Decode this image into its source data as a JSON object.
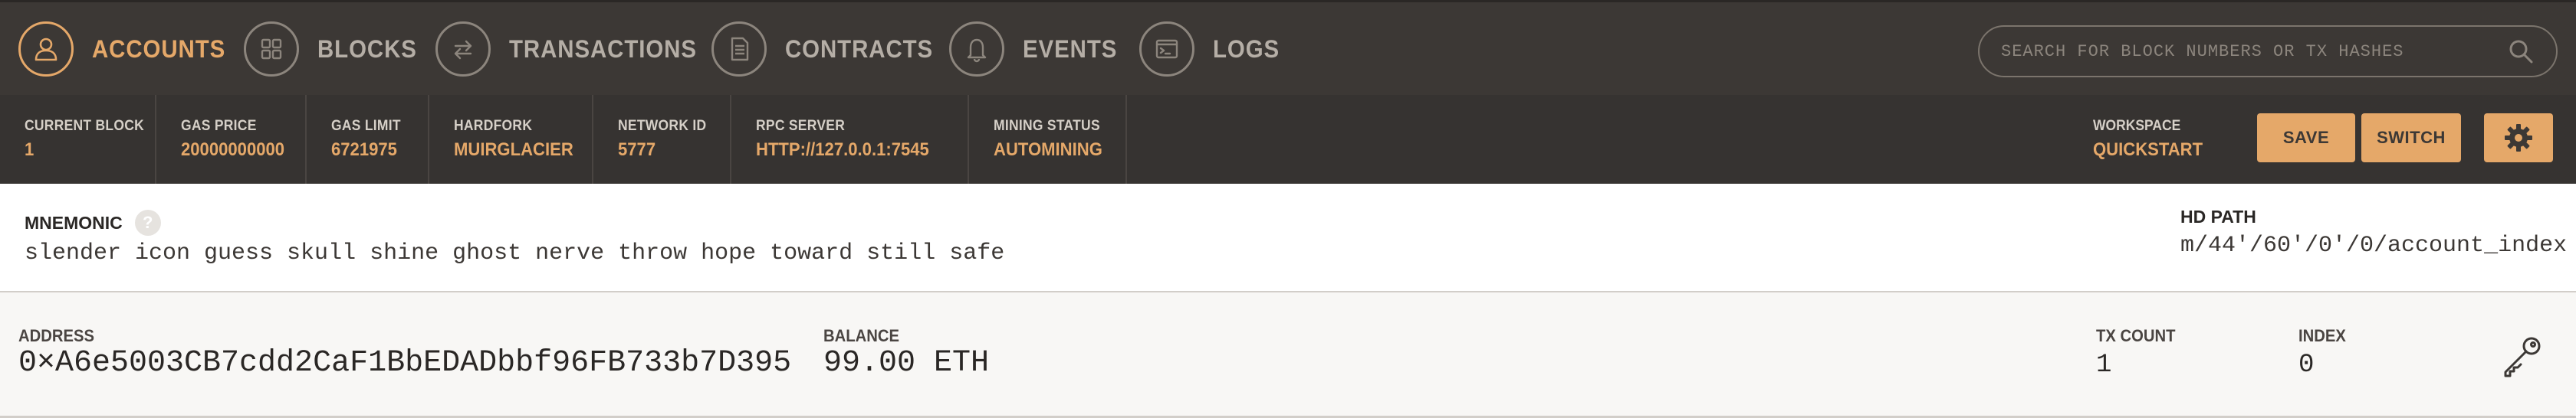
{
  "nav": {
    "items": [
      {
        "label": "ACCOUNTS",
        "icon": "user-icon",
        "active": true
      },
      {
        "label": "BLOCKS",
        "icon": "grid-icon",
        "active": false
      },
      {
        "label": "TRANSACTIONS",
        "icon": "swap-arrows-icon",
        "active": false
      },
      {
        "label": "CONTRACTS",
        "icon": "document-icon",
        "active": false
      },
      {
        "label": "EVENTS",
        "icon": "bell-icon",
        "active": false
      },
      {
        "label": "LOGS",
        "icon": "terminal-icon",
        "active": false
      }
    ],
    "search_placeholder": "SEARCH FOR BLOCK NUMBERS OR TX HASHES"
  },
  "status": {
    "current_block": {
      "label": "CURRENT BLOCK",
      "value": "1"
    },
    "gas_price": {
      "label": "GAS PRICE",
      "value": "20000000000"
    },
    "gas_limit": {
      "label": "GAS LIMIT",
      "value": "6721975"
    },
    "hardfork": {
      "label": "HARDFORK",
      "value": "MUIRGLACIER"
    },
    "network_id": {
      "label": "NETWORK ID",
      "value": "5777"
    },
    "rpc_server": {
      "label": "RPC SERVER",
      "value": "HTTP://127.0.0.1:7545"
    },
    "mining_status": {
      "label": "MINING STATUS",
      "value": "AUTOMINING"
    },
    "workspace": {
      "label": "WORKSPACE",
      "value": "QUICKSTART"
    },
    "save_label": "SAVE",
    "switch_label": "SWITCH"
  },
  "mnemonic": {
    "label": "MNEMONIC",
    "help": "?",
    "words": "slender icon guess skull shine ghost nerve throw hope toward still safe",
    "hd_path_label": "HD PATH",
    "hd_path_value": "m/44'/60'/0'/0/account_index"
  },
  "account": {
    "address_label": "ADDRESS",
    "address": "0×A6e5003CB7cdd2CaF1BbEDADbbf96FB733b7D395",
    "balance_label": "BALANCE",
    "balance": "99.00 ETH",
    "tx_count_label": "TX COUNT",
    "tx_count": "1",
    "index_label": "INDEX",
    "index": "0"
  },
  "colors": {
    "accent": "#e5a869",
    "nav_bg": "#3c3835",
    "status_bg": "#363331"
  }
}
